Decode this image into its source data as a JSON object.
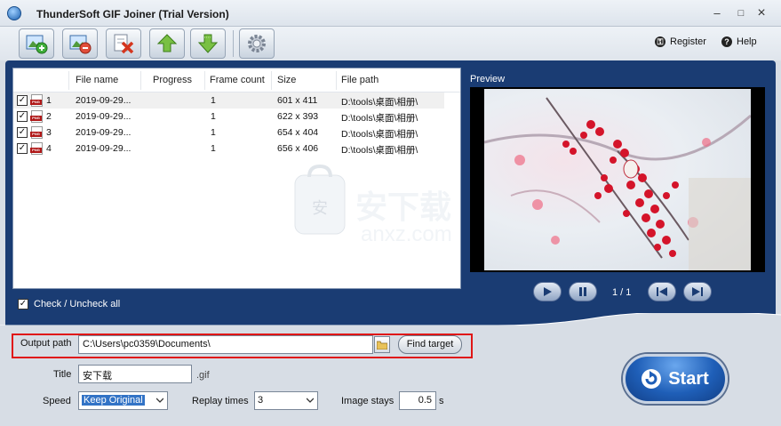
{
  "window": {
    "title": "ThunderSoft GIF Joiner (Trial Version)",
    "minimize": "–",
    "maximize": "□",
    "close": "×"
  },
  "toolbar": {
    "buttons": [
      {
        "name": "add-image-icon"
      },
      {
        "name": "remove-image-icon"
      },
      {
        "name": "delete-all-icon"
      },
      {
        "name": "move-up-icon"
      },
      {
        "name": "move-down-icon"
      },
      {
        "name": "settings-gear-icon"
      }
    ],
    "register_label": "Register",
    "help_label": "Help"
  },
  "file_list": {
    "columns": [
      "File name",
      "Progress",
      "Frame count",
      "Size",
      "File path"
    ],
    "rows": [
      {
        "index": "1",
        "name": "2019-09-29...",
        "progress": "",
        "frames": "1",
        "size": "601 x 411",
        "path": "D:\\tools\\桌面\\相册\\",
        "checked": true,
        "selected": true
      },
      {
        "index": "2",
        "name": "2019-09-29...",
        "progress": "",
        "frames": "1",
        "size": "622 x 393",
        "path": "D:\\tools\\桌面\\相册\\",
        "checked": true,
        "selected": false
      },
      {
        "index": "3",
        "name": "2019-09-29...",
        "progress": "",
        "frames": "1",
        "size": "654 x 404",
        "path": "D:\\tools\\桌面\\相册\\",
        "checked": true,
        "selected": false
      },
      {
        "index": "4",
        "name": "2019-09-29...",
        "progress": "",
        "frames": "1",
        "size": "656 x 406",
        "path": "D:\\tools\\桌面\\相册\\",
        "checked": true,
        "selected": false
      }
    ],
    "file_badge": "PNG",
    "check_all_label": "Check / Uncheck all",
    "check_mark": "✓"
  },
  "preview": {
    "label": "Preview",
    "page_indicator": "1 / 1"
  },
  "output": {
    "path_label": "Output path",
    "path_value": "C:\\Users\\pc0359\\Documents\\",
    "find_target_label": "Find target",
    "title_label": "Title",
    "title_value": "安下载",
    "extension": ".gif",
    "speed_label": "Speed",
    "speed_value": "Keep Original",
    "replay_label": "Replay times",
    "replay_value": "3",
    "stays_label": "Image stays",
    "stays_value": "0.5",
    "stays_unit": "s"
  },
  "start_label": "Start",
  "watermark": {
    "cn": "安下载",
    "url": "anxz.com"
  },
  "colors": {
    "panel_blue": "#1a3c73",
    "highlight_red": "#e01616",
    "start_blue": "#1f5fb8"
  }
}
